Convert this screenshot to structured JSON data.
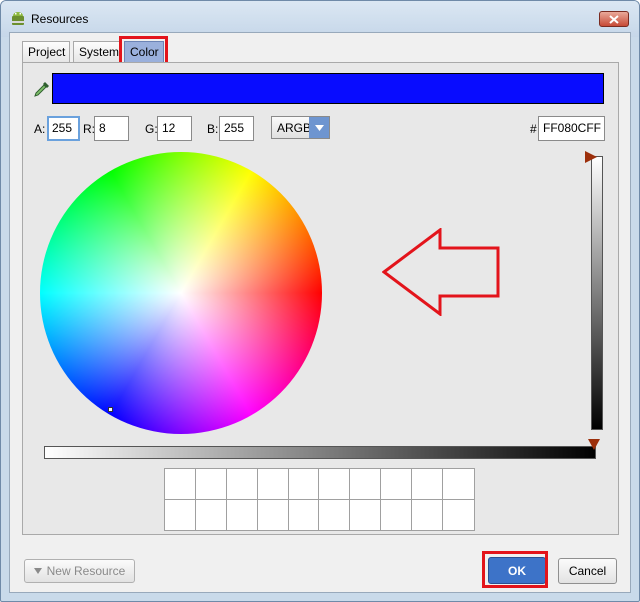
{
  "window": {
    "title": "Resources",
    "close_icon": "close-icon"
  },
  "tabs": [
    {
      "label": "Project"
    },
    {
      "label": "System"
    },
    {
      "label": "Color",
      "active": true
    }
  ],
  "color": {
    "preview_hex": "#080CFF",
    "a_label": "A:",
    "a_value": "255",
    "r_label": "R:",
    "r_value": "8",
    "g_label": "G:",
    "g_value": "12",
    "b_label": "B:",
    "b_value": "255",
    "format": "ARGB",
    "hash_label": "#",
    "hex_value": "FF080CFF"
  },
  "buttons": {
    "new_resource": "New Resource",
    "ok": "OK",
    "cancel": "Cancel"
  },
  "colors": {
    "annotation": "#e3141b",
    "ok_button": "#3d73c8",
    "slider_thumb": "#9c2f0b"
  }
}
